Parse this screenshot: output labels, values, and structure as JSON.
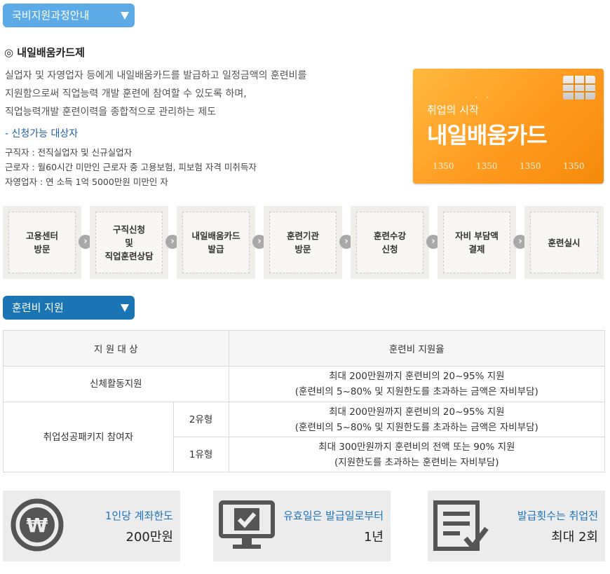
{
  "tabs": {
    "course_guide": "국비지원과정안내",
    "training_support": "훈련비 지원"
  },
  "card_intro": {
    "title": "◎ 내일배움카드제",
    "description": [
      "실업자 및 자영업자 등에게 내일배움카드를 발급하고 일정금액의 훈련비를",
      "지원함으로써 직업능력 개발 훈련에 참여할 수 있도록 하며,",
      "직업능력개발 훈련이력을 종합적으로 관리하는 제도"
    ],
    "target_heading": "- 신청가능 대상자",
    "targets": [
      "구직자 : 전직실업자 및 신규실업자",
      "근로자 : 월60시간 미만인 근로자 중 고용보험, 피보험 자격 미취득자",
      "자영업자 : 연 소득 1억 5000만원 미만인 자"
    ]
  },
  "card_image": {
    "slogan": "취업의 시작",
    "dots": "··",
    "brand": "내일배움카드",
    "numbers": [
      "1350",
      "1350",
      "1350",
      "1350"
    ]
  },
  "steps": [
    [
      "고용센터",
      "방문"
    ],
    [
      "구직신청",
      "및",
      "직업훈련상담"
    ],
    [
      "내일배움카드",
      "발급"
    ],
    [
      "훈련기관",
      "방문"
    ],
    [
      "훈련수강",
      "신청"
    ],
    [
      "자비 부담액",
      "결제"
    ],
    [
      "훈련실시"
    ]
  ],
  "step_arrow_glyph": "›",
  "table": {
    "headers": {
      "target": "지 원 대 상",
      "rate": "훈련비 지원율"
    },
    "rows": {
      "physical": {
        "target": "신체활동지원",
        "rate": [
          "최대 200만원까지 훈련비의 20~95% 지원",
          "(훈련비의 5~80% 및 지원한도를 초과하는 금액은 자비부담)"
        ]
      },
      "package": {
        "target": "취업성공패키지 참여자",
        "type2": {
          "label": "2유형",
          "rate": [
            "최대 200만원까지 훈련비의 20~95% 지원",
            "(훈련비의 5~80% 및 지원한도를 초과하는 금액은 자비부담)"
          ]
        },
        "type1": {
          "label": "1유형",
          "rate": [
            "최대 300만원까지 훈련비의 전액 또는 90% 지원",
            "(지원한도를 초과하는 훈련비는 자비부담)"
          ]
        }
      }
    }
  },
  "info_boxes": [
    {
      "icon": "won-coin-icon",
      "label": "1인당 계좌한도",
      "value": "200만원"
    },
    {
      "icon": "monitor-check-icon",
      "label": "유효일은 발급일로부터",
      "value": "1년"
    },
    {
      "icon": "document-check-icon",
      "label": "발급횟수는 취업전",
      "value": "최대 2회"
    }
  ],
  "colors": {
    "tab_light": "#5cabe6",
    "tab_dark": "#1b74b3",
    "link_blue": "#1e73be",
    "card_orange": "#ff9a1f",
    "icon_gray": "#555555"
  },
  "icon_glyphs": {
    "won": "₩"
  }
}
